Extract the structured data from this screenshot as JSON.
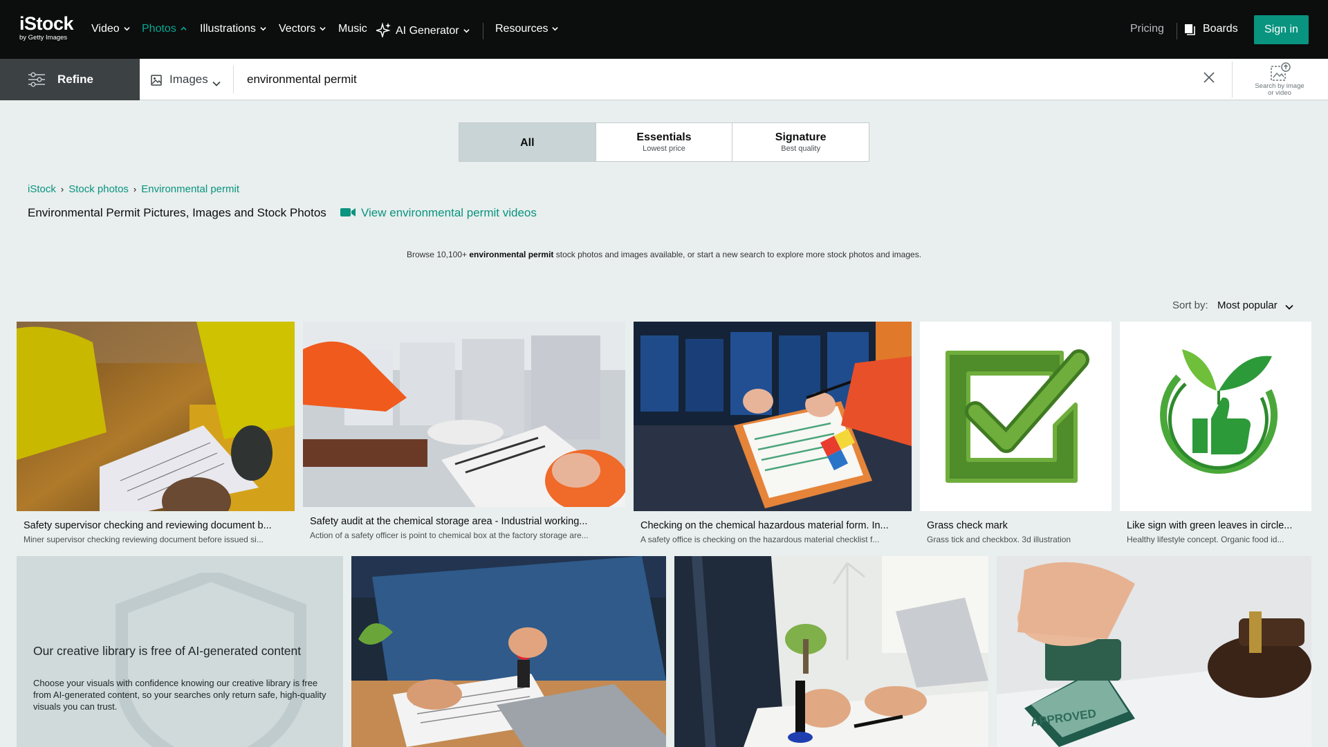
{
  "nav": {
    "logo_main": "iStock",
    "logo_sub": "by Getty Images",
    "items": [
      {
        "label": "Video"
      },
      {
        "label": "Photos"
      },
      {
        "label": "Illustrations"
      },
      {
        "label": "Vectors"
      },
      {
        "label": "Music"
      },
      {
        "label": "AI Generator"
      },
      {
        "label": "Resources"
      }
    ],
    "pricing": "Pricing",
    "boards": "Boards",
    "sign_in": "Sign in"
  },
  "search": {
    "refine_label": "Refine",
    "media_type": "Images",
    "query": "environmental permit",
    "search_by_image_line1": "Search by image",
    "search_by_image_line2": "or video"
  },
  "tiers": [
    {
      "title": "All",
      "subtitle": ""
    },
    {
      "title": "Essentials",
      "subtitle": "Lowest price"
    },
    {
      "title": "Signature",
      "subtitle": "Best quality"
    }
  ],
  "breadcrumb": [
    "iStock",
    "Stock photos",
    "Environmental permit"
  ],
  "page_title": "Environmental Permit Pictures, Images and Stock Photos",
  "video_link": "View environmental permit videos",
  "browse": {
    "prefix": "Browse 10,100+ ",
    "keyword": "environmental permit",
    "suffix": " stock photos and images available, or start a new search to explore more stock photos and images."
  },
  "sort": {
    "label": "Sort by:",
    "value": "Most popular"
  },
  "results_row1": [
    {
      "title": "Safety supervisor checking and reviewing document b...",
      "description": "Miner supervisor checking reviewing document before issued si..."
    },
    {
      "title": "Safety audit at the chemical storage area - Industrial working...",
      "description": "Action of a safety officer is point to chemical box at the factory storage are..."
    },
    {
      "title": "Checking on the chemical hazardous material form. In...",
      "description": "A safety office is checking on the hazardous material checklist f..."
    },
    {
      "title": "Grass check mark",
      "description": "Grass tick and checkbox. 3d illustration"
    },
    {
      "title": "Like sign with green leaves in circle...",
      "description": "Healthy lifestyle concept. Organic food id..."
    }
  ],
  "ai_notice": {
    "title": "Our creative library is free of AI-generated content",
    "body": "Choose your visuals with confidence knowing our creative library is free from AI-generated content, so your searches only return safe, high-quality visuals you can trust."
  },
  "stamp_text": "APPROVED",
  "colors": {
    "accent": "#08947f",
    "nav_bg": "#0c0d0d",
    "page_bg": "#e9eeee"
  }
}
